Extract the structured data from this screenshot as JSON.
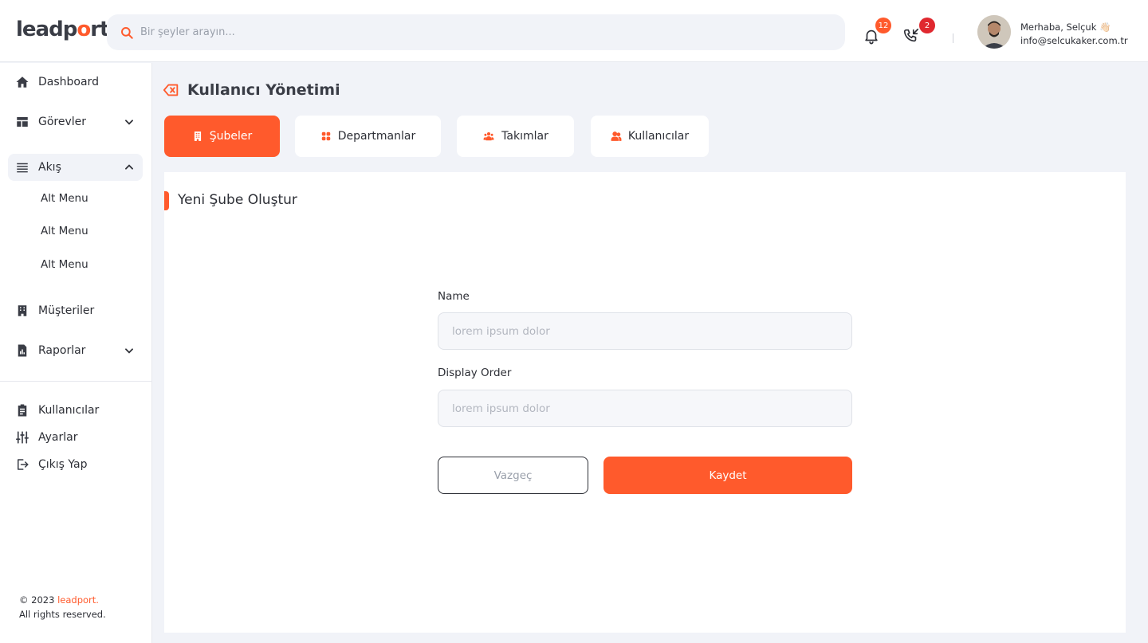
{
  "colors": {
    "accent": "#ff5a2c",
    "notif_badge": "#ff5a2c",
    "call_badge": "#e0282f",
    "logo_dot": "#1ca6e0"
  },
  "header": {
    "logo": {
      "part1": "leadp",
      "part2": "o",
      "part3": "rt"
    },
    "search": {
      "placeholder": "Bir şeyler arayın...",
      "icon": "search-icon"
    },
    "notifications": {
      "count": "12",
      "icon": "bell-icon"
    },
    "calls": {
      "count": "2",
      "icon": "phone-incoming-icon"
    },
    "user": {
      "greeting": "Merhaba, Selçuk 👋🏻",
      "email": "info@selcukaker.com.tr"
    }
  },
  "sidebar": {
    "items": [
      {
        "label": "Dashboard",
        "icon": "home-icon"
      },
      {
        "label": "Görevler",
        "icon": "layout-icon"
      },
      {
        "label": "Akış",
        "icon": "list-icon"
      },
      {
        "label": "Müşteriler",
        "icon": "building-icon"
      },
      {
        "label": "Raporlar",
        "icon": "report-icon"
      }
    ],
    "submenu": [
      "Alt Menu",
      "Alt Menu",
      "Alt Menu"
    ],
    "bottom": [
      {
        "label": "Kullanıcılar",
        "icon": "clipboard-icon"
      },
      {
        "label": "Ayarlar",
        "icon": "sliders-icon"
      },
      {
        "label": "Çıkış Yap",
        "icon": "logout-icon"
      }
    ],
    "footer": {
      "copyright": "© 2023 ",
      "brand": "leadport.",
      "rights": "All rights reserved."
    }
  },
  "page": {
    "title": "Kullanıcı Yönetimi",
    "tabs": [
      {
        "label": "Şubeler",
        "icon": "building-icon",
        "active": true
      },
      {
        "label": "Departmanlar",
        "icon": "grid-icon",
        "active": false
      },
      {
        "label": "Takımlar",
        "icon": "team-icon",
        "active": false
      },
      {
        "label": "Kullanıcılar",
        "icon": "users-icon",
        "active": false
      }
    ]
  },
  "form": {
    "title": "Yeni Şube Oluştur",
    "name_label": "Name",
    "name_placeholder": "lorem ipsum dolor",
    "order_label": "Display Order",
    "order_placeholder": "lorem ipsum dolor",
    "cancel_label": "Vazgeç",
    "save_label": "Kaydet"
  }
}
